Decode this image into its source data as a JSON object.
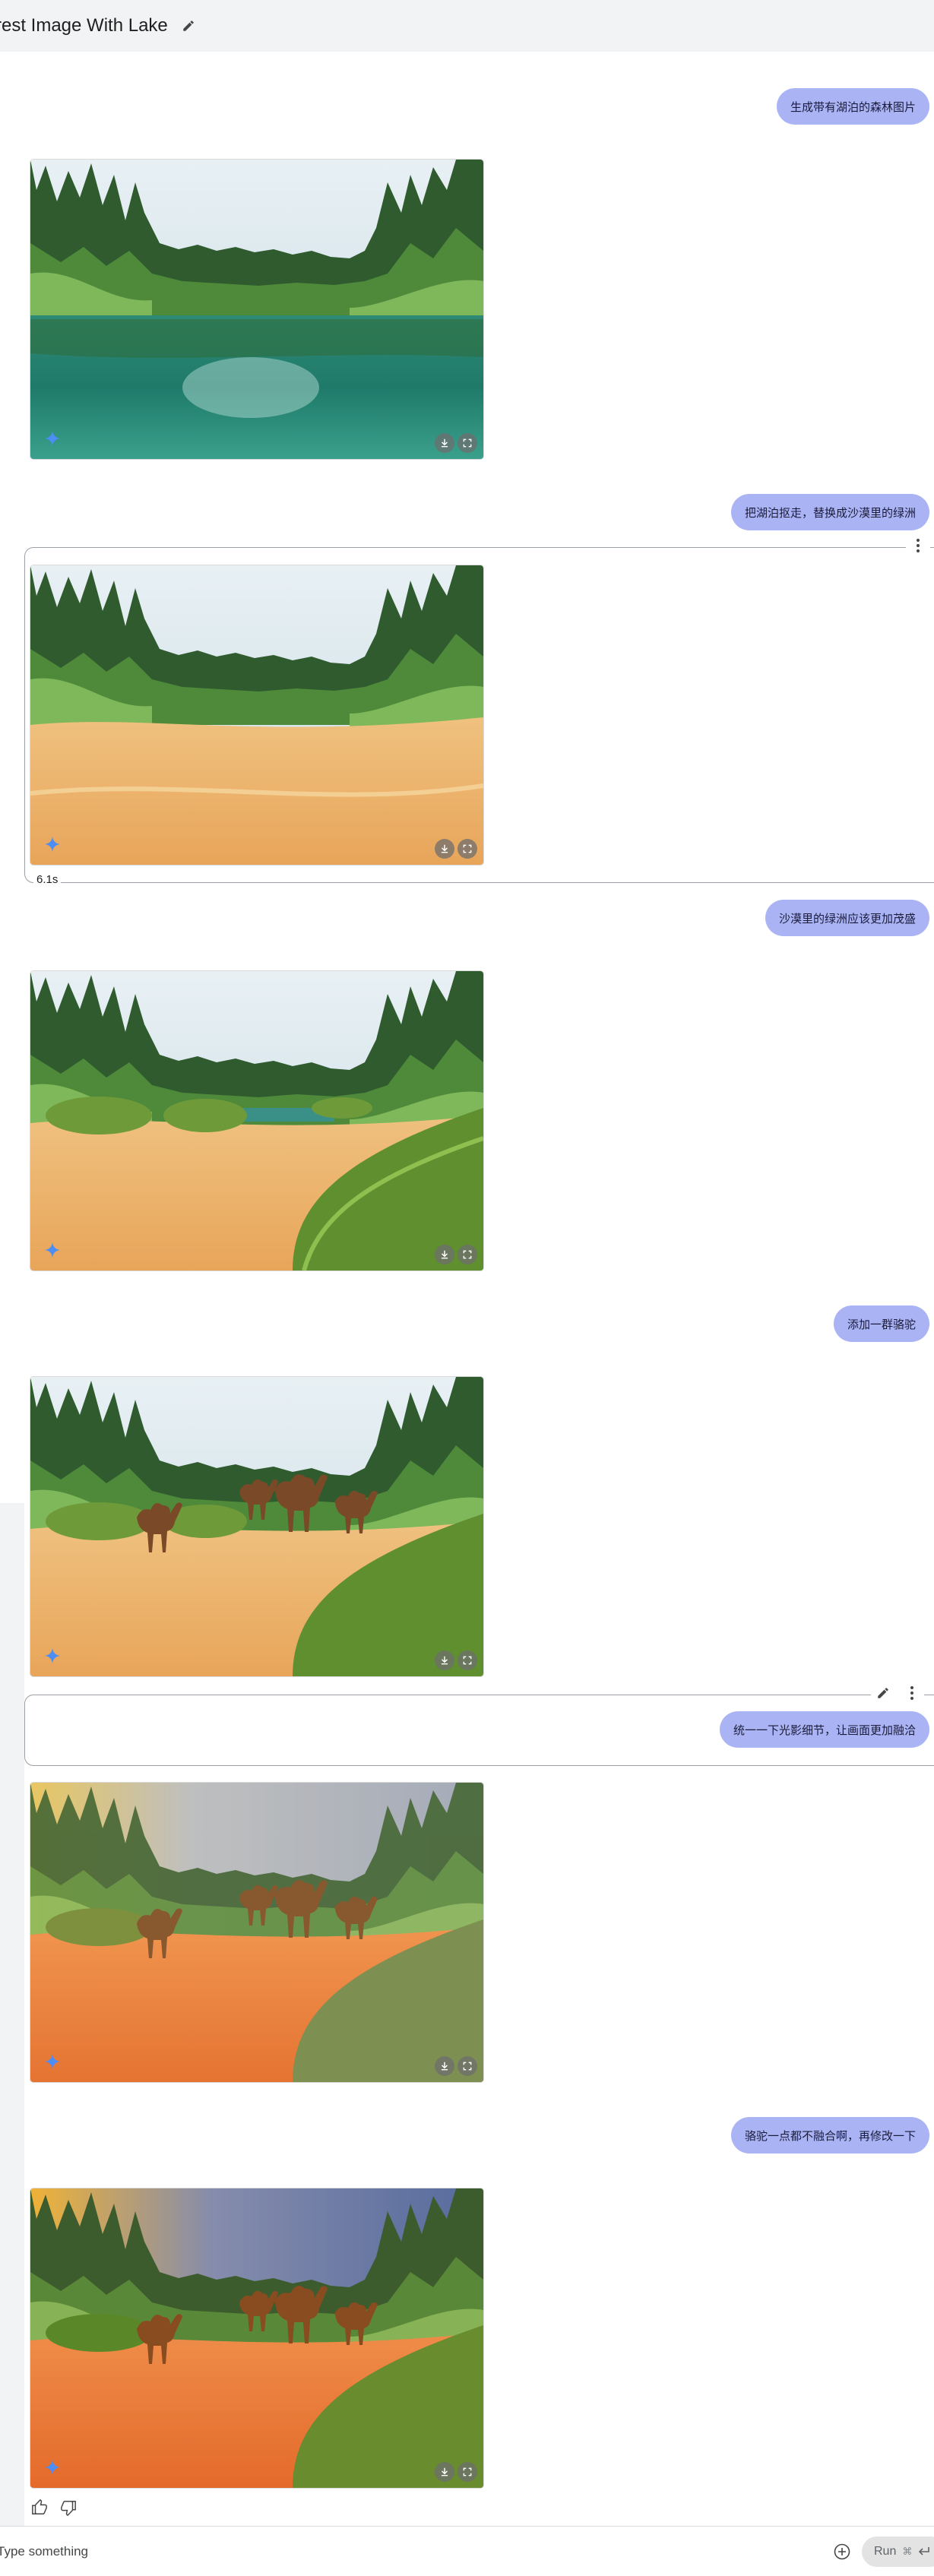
{
  "header": {
    "title": "rest Image With Lake"
  },
  "turns": [
    {
      "user": "生成带有湖泊的森林图片"
    },
    {
      "user": "把湖泊抠走，替换成沙漠里的绿洲",
      "time": "6.1s"
    },
    {
      "user": "沙漠里的绿洲应该更加茂盛"
    },
    {
      "user": "添加一群骆驼"
    },
    {
      "user": "统一一下光影细节，让画面更加融洽"
    },
    {
      "user": "骆驼一点都不融合啊，再修改一下"
    }
  ],
  "input": {
    "placeholder": "Type something"
  },
  "run": {
    "label": "Run",
    "shortcut": "⌘"
  },
  "colors": {
    "user_bubble": "#aab4f5",
    "gemini_spark": "#4c8df6",
    "header_bg": "#f1f3f4"
  }
}
